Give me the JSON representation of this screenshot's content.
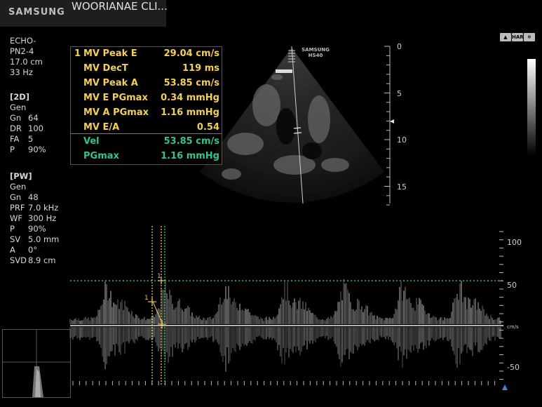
{
  "header": {
    "brand": "SAMSUNG",
    "clinic": "WOORIANAE CLI..."
  },
  "probe": {
    "lines": [
      "ECHO-",
      "PN2-4",
      "17.0 cm",
      "33 Hz"
    ]
  },
  "twod": {
    "title": "[2D]",
    "mode": "Gen",
    "params": [
      {
        "k": "Gn",
        "v": "64"
      },
      {
        "k": "DR",
        "v": "100"
      },
      {
        "k": "FA",
        "v": "5"
      },
      {
        "k": "P",
        "v": "90%"
      }
    ]
  },
  "pw": {
    "title": "[PW]",
    "mode": "Gen",
    "params": [
      {
        "k": "Gn",
        "v": "48"
      },
      {
        "k": "PRF",
        "v": "7.0 kHz"
      },
      {
        "k": "WF",
        "v": "300 Hz"
      },
      {
        "k": "P",
        "v": "90%"
      },
      {
        "k": "SV",
        "v": "5.0 mm"
      },
      {
        "k": "A",
        "v": "0°"
      },
      {
        "k": "SVD",
        "v": "8.9 cm"
      }
    ]
  },
  "measurements": {
    "index": "1",
    "rows": [
      {
        "label": "MV Peak E",
        "value": "29.04 cm/s"
      },
      {
        "label": "MV DecT",
        "value": "119 ms"
      },
      {
        "label": "MV Peak A",
        "value": "53.85 cm/s"
      },
      {
        "label": "MV E PGmax",
        "value": "0.34 mmHg"
      },
      {
        "label": "MV A PGmax",
        "value": "1.16 mmHg"
      },
      {
        "label": "MV E/A",
        "value": "0.54"
      }
    ],
    "vel_rows": [
      {
        "label": "Vel",
        "value": "53.85 cm/s"
      },
      {
        "label": "PGmax",
        "value": "1.16 mmHg"
      }
    ]
  },
  "image_watermark": {
    "line1": "SAMSUNG",
    "line2": "HS40"
  },
  "depth_scale": {
    "labels": [
      "0",
      "5",
      "10",
      "15"
    ]
  },
  "doppler_scale": {
    "labels": [
      "100",
      "50",
      "cm/s",
      "-50"
    ]
  },
  "markers": {
    "e": "1",
    "a": "1"
  },
  "icons": {
    "first": "probe-icon",
    "second": "HAR",
    "third": "freeze-icon"
  }
}
